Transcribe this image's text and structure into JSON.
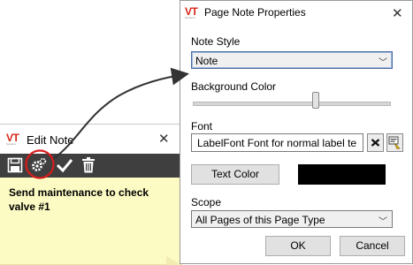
{
  "edit_note": {
    "title": "Edit Note",
    "logo_text": "VT",
    "note_text": "Send maintenance to check valve #1",
    "toolbar": {
      "icons": [
        "save-icon",
        "properties-gears-icon",
        "check-icon",
        "trash-icon"
      ]
    }
  },
  "page_note_properties": {
    "title": "Page Note Properties",
    "logo_text": "VT",
    "note_style": {
      "label": "Note Style",
      "value": "Note"
    },
    "background_color": {
      "label": "Background Color",
      "slider_level": 0.62
    },
    "font": {
      "label": "Font",
      "value": "LabelFont    Font for normal label te"
    },
    "text_color": {
      "button_label": "Text Color",
      "swatch_color": "#000000"
    },
    "scope": {
      "label": "Scope",
      "value": "All Pages of this Page Type"
    },
    "ok_label": "OK",
    "cancel_label": "Cancel"
  },
  "colors": {
    "note_background": "#fdfbc4",
    "toolbar_background": "#3f3f3f",
    "logo_red": "#d62718",
    "highlight_circle": "#d81b1b"
  }
}
